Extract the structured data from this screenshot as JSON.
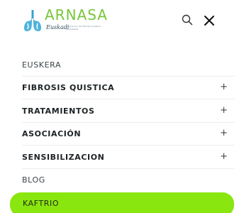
{
  "header": {
    "logo": {
      "title": "ARNASA",
      "script": "Euskadi",
      "tagline": "Asociación de Fibrosis Quística de Euskadi"
    },
    "search_icon": "search-icon",
    "close_icon": "close-icon"
  },
  "menu": {
    "items": [
      {
        "label": "EUSKERA",
        "has_submenu": false
      },
      {
        "label": "FIBROSIS QUISTICA",
        "has_submenu": true,
        "toggle": "+"
      },
      {
        "label": "TRATAMIENTOS",
        "has_submenu": true,
        "toggle": "+"
      },
      {
        "label": "ASOCIACIÓN",
        "has_submenu": true,
        "toggle": "+"
      },
      {
        "label": "SENSIBILIZACION",
        "has_submenu": true,
        "toggle": "+"
      },
      {
        "label": "BLOG",
        "has_submenu": false
      }
    ],
    "cta": {
      "label": "KAFTRIO"
    }
  },
  "colors": {
    "brand_green": "#77c63a",
    "cta_background": "#8ae60f",
    "text_dark": "#1d2225",
    "logo_blue": "#4fb3dc"
  }
}
